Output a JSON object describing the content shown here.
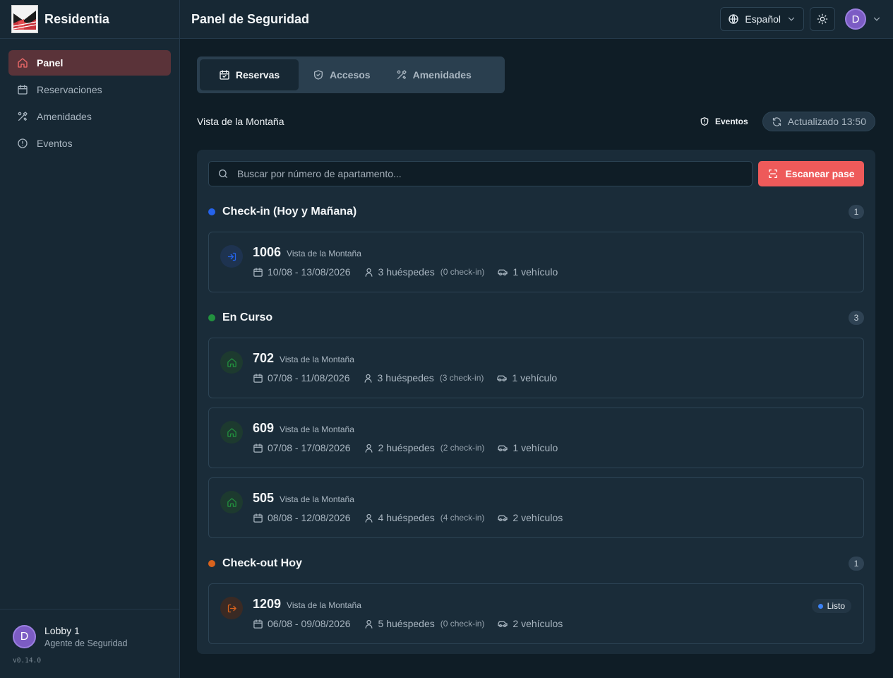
{
  "app": {
    "name": "Residentia",
    "version": "v0.14.0"
  },
  "sidebar": {
    "items": [
      {
        "label": "Panel",
        "icon": "home-icon",
        "active": true
      },
      {
        "label": "Reservaciones",
        "icon": "calendar-icon",
        "active": false
      },
      {
        "label": "Amenidades",
        "icon": "amenities-icon",
        "active": false
      },
      {
        "label": "Eventos",
        "icon": "alert-circle-icon",
        "active": false
      }
    ],
    "user": {
      "initial": "D",
      "name": "Lobby 1",
      "role": "Agente de Seguridad"
    }
  },
  "header": {
    "title": "Panel de Seguridad",
    "language": "Español",
    "user_initial": "D"
  },
  "tabs": [
    {
      "label": "Reservas",
      "icon": "calendar-check-icon",
      "active": true
    },
    {
      "label": "Accesos",
      "icon": "shield-check-icon",
      "active": false
    },
    {
      "label": "Amenidades",
      "icon": "amenities-icon",
      "active": false
    }
  ],
  "toolbar": {
    "location": "Vista de la Montaña",
    "events_label": "Eventos",
    "updated_label": "Actualizado 13:50"
  },
  "search": {
    "placeholder": "Buscar por número de apartamento...",
    "value": "",
    "scan_label": "Escanear pase"
  },
  "colors": {
    "accent": "#ee5a5a",
    "checkin": "#2563eb",
    "in_progress": "#22923f",
    "checkout": "#d9631d"
  },
  "sections": [
    {
      "title": "Check-in (Hoy y Mañana)",
      "count": "1",
      "color": "#2563eb",
      "cards": [
        {
          "unit": "1006",
          "complex": "Vista de la Montaña",
          "dates": "10/08 - 13/08/2026",
          "guests": "3 huéspedes",
          "checkins": "(0 check-in)",
          "vehicles": "1 vehículo",
          "badge": ""
        }
      ]
    },
    {
      "title": "En Curso",
      "count": "3",
      "color": "#22923f",
      "cards": [
        {
          "unit": "702",
          "complex": "Vista de la Montaña",
          "dates": "07/08 - 11/08/2026",
          "guests": "3 huéspedes",
          "checkins": "(3 check-in)",
          "vehicles": "1 vehículo",
          "badge": ""
        },
        {
          "unit": "609",
          "complex": "Vista de la Montaña",
          "dates": "07/08 - 17/08/2026",
          "guests": "2 huéspedes",
          "checkins": "(2 check-in)",
          "vehicles": "1 vehículo",
          "badge": ""
        },
        {
          "unit": "505",
          "complex": "Vista de la Montaña",
          "dates": "08/08 - 12/08/2026",
          "guests": "4 huéspedes",
          "checkins": "(4 check-in)",
          "vehicles": "2 vehículos",
          "badge": ""
        }
      ]
    },
    {
      "title": "Check-out Hoy",
      "count": "1",
      "color": "#d9631d",
      "cards": [
        {
          "unit": "1209",
          "complex": "Vista de la Montaña",
          "dates": "06/08 - 09/08/2026",
          "guests": "5 huéspedes",
          "checkins": "(0 check-in)",
          "vehicles": "2 vehículos",
          "badge": "Listo"
        }
      ]
    }
  ]
}
